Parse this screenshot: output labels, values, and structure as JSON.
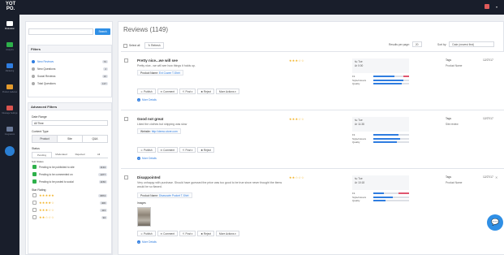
{
  "app": {
    "logo": "YOT PO.",
    "user_menu": "▾"
  },
  "nav": {
    "items": [
      {
        "label": "Moderation",
        "active": true
      },
      {
        "label": "Analytics",
        "active": false
      },
      {
        "label": "Marketing",
        "active": false
      },
      {
        "label": "Product Galleries",
        "active": false
      },
      {
        "label": "Message Settings",
        "active": false
      },
      {
        "label": "Integrations",
        "active": false
      }
    ]
  },
  "filters": {
    "search_placeholder": "",
    "search_button": "Search",
    "title": "Filters",
    "items": [
      {
        "label": "New Reviews",
        "count": "70",
        "selected": true
      },
      {
        "label": "New Questions",
        "count": "2",
        "selected": false
      },
      {
        "label": "Social Reviews",
        "count": "10",
        "selected": false
      },
      {
        "label": "Total Questions",
        "count": "137",
        "selected": false
      }
    ],
    "advanced_title": "Advanced Filters",
    "date_range_label": "Date Range",
    "date_range_value": "All Time",
    "content_type_label": "Content Type",
    "content_types": [
      "Product",
      "Site",
      "Q&A"
    ],
    "status_label": "Status",
    "status_tabs": [
      "Pending",
      "Moderated",
      "Rejected",
      "All"
    ],
    "sub_status_label": "Sub Status",
    "sub_status": [
      {
        "label": "Pending to be published to site",
        "count": "1134"
      },
      {
        "label": "Pending to be commented on",
        "count": "1077"
      },
      {
        "label": "Pending to be posted to social",
        "count": "1150"
      }
    ],
    "star_rating_label": "Star Rating",
    "star_rows": [
      {
        "stars": "★★★★★",
        "count": "6874"
      },
      {
        "stars": "★★★★☆",
        "count": "406"
      },
      {
        "stars": "★★★☆☆",
        "count": "113"
      },
      {
        "stars": "★★☆☆☆",
        "count": "94"
      }
    ]
  },
  "main": {
    "title": "Reviews (1149)",
    "select_all": "Select all",
    "refresh": "↻ Refresh",
    "results_label": "Results per page:",
    "results_value": "20",
    "sort_label": "Sort by:",
    "sort_value": "Date (newest first)",
    "reviews": [
      {
        "title": "Pretty nice...we will see",
        "body": "Pretty nice...we will see how things it holds up.",
        "product_label": "Product Name:",
        "product": "Ext Cozee T-Shirt",
        "stars": "★★★☆☆",
        "meta1": "№ Tue",
        "meta2": "Ar 0:00",
        "tags": "Tags",
        "tag_value": "Product Name",
        "date": "12/27/17",
        "actions": [
          "☺ Publish",
          "✉ Comment",
          "⇱ Post ▾",
          "✖ Reject",
          "More Actions ▾"
        ],
        "more": "More Details"
      },
      {
        "title": "Good not great",
        "body": "Liked the clothes but shipping was slow",
        "product_label": "Website:",
        "product": "http://demo-store.com",
        "stars": "★★★☆☆",
        "meta1": "№ Tue",
        "meta2": "Ar 11:38",
        "tags": "Tags",
        "tag_value": "Site review",
        "date": "12/27/17",
        "actions": [
          "☺ Publish",
          "✉ Comment",
          "⇱ Post ▾",
          "✖ Reject"
        ],
        "more": "More Details"
      },
      {
        "title": "Disappointed",
        "body": "Very unhappy with purchase. Should have guessed the price was too good to be true since never thought the items would be so flawed.",
        "product_label": "Product Name:",
        "product": "Disavowie Pocket T-Shirt",
        "stars": "★★☆☆☆",
        "meta1": "№ Tue",
        "meta2": "Ar 10:18",
        "tags": "Tags",
        "tag_value": "Product Name",
        "date": "12/27/17",
        "actions": [
          "☺ Publish",
          "✉ Comment",
          "⇱ Post ▾",
          "✖ Reject",
          "More Actions ▾"
        ],
        "more": "More Details",
        "images_label": "Images"
      }
    ],
    "bar_labels": [
      "Fit",
      "Style/colours",
      "Quality"
    ]
  }
}
